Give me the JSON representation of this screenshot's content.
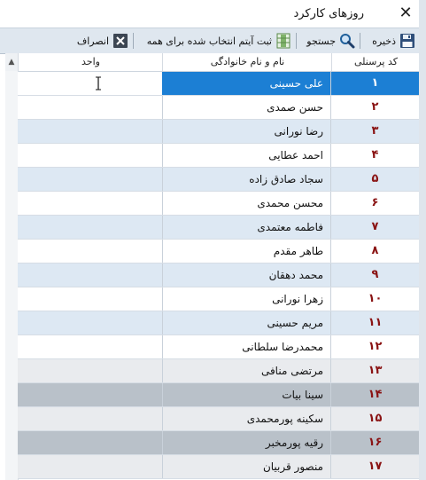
{
  "window": {
    "title": "روزهای کارکرد",
    "close_glyph": "✕"
  },
  "toolbar": {
    "save_label": "ذخیره",
    "search_label": "جستجو",
    "apply_all_label": "ثبت آیتم انتخاب شده برای همه",
    "cancel_label": "انصراف"
  },
  "grid": {
    "headers": {
      "code": "کد پرسنلی",
      "name": "نام و نام خانوادگی",
      "unit": "واحد"
    },
    "rows": [
      {
        "code": "۱",
        "name": "علی حسینی",
        "unit": ""
      },
      {
        "code": "۲",
        "name": "حسن صمدی",
        "unit": ""
      },
      {
        "code": "۳",
        "name": "رضا نورانی",
        "unit": ""
      },
      {
        "code": "۴",
        "name": "احمد عطایی",
        "unit": ""
      },
      {
        "code": "۵",
        "name": "سجاد صادق زاده",
        "unit": ""
      },
      {
        "code": "۶",
        "name": "محسن محمدی",
        "unit": ""
      },
      {
        "code": "۷",
        "name": "فاطمه معتمدی",
        "unit": ""
      },
      {
        "code": "۸",
        "name": "طاهر مقدم",
        "unit": ""
      },
      {
        "code": "۹",
        "name": "محمد دهقان",
        "unit": ""
      },
      {
        "code": "۱۰",
        "name": "زهرا نورانی",
        "unit": ""
      },
      {
        "code": "۱۱",
        "name": "مریم حسینی",
        "unit": ""
      },
      {
        "code": "۱۲",
        "name": "محمدرضا سلطانی",
        "unit": ""
      },
      {
        "code": "۱۳",
        "name": "مرتضی منافی",
        "unit": ""
      },
      {
        "code": "۱۴",
        "name": "سینا بیات",
        "unit": ""
      },
      {
        "code": "۱۵",
        "name": "سکینه پورمحمدی",
        "unit": ""
      },
      {
        "code": "۱۶",
        "name": "رقیه پورمخبر",
        "unit": ""
      },
      {
        "code": "۱۷",
        "name": "منصور قربیان",
        "unit": ""
      }
    ]
  },
  "colors": {
    "selected": "#1c7fd4",
    "row_light": "#dde8f3",
    "row_white": "#ffffff",
    "row_gray": "#b9c1c9",
    "row_gray_alt": "#e9ebee",
    "code_text": "#8a1414"
  },
  "icons": {
    "save": "floppy-disk-icon",
    "search": "magnifier-icon",
    "apply_all": "columns-icon",
    "cancel": "close-box-icon"
  }
}
